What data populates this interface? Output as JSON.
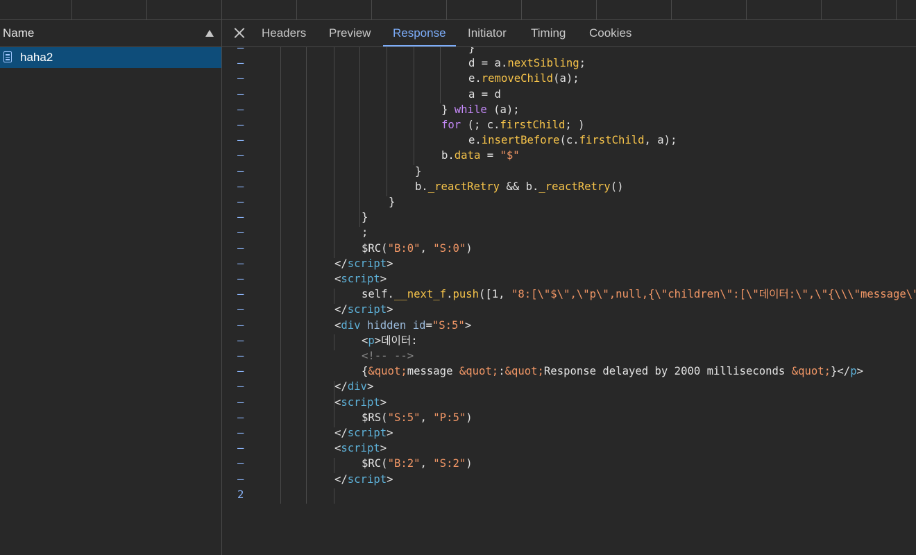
{
  "left_pane": {
    "column_header": "Name",
    "request_name": "haha2"
  },
  "tabs": [
    {
      "label": "Headers",
      "active": false
    },
    {
      "label": "Preview",
      "active": false
    },
    {
      "label": "Response",
      "active": true
    },
    {
      "label": "Initiator",
      "active": false
    },
    {
      "label": "Timing",
      "active": false
    },
    {
      "label": "Cookies",
      "active": false
    }
  ],
  "colors": {
    "accent": "#7cacf8",
    "keyword": "#c58af9",
    "property": "#f7c44a",
    "string": "#f29766",
    "tag": "#5db0d7",
    "selected_row": "#0e4d7a"
  },
  "code_lines": [
    {
      "num": "–",
      "tokens": [
        {
          "t": "}",
          "k": "c"
        }
      ]
    },
    {
      "num": "–",
      "tokens": [
        {
          "t": "d = a.",
          "k": "c"
        },
        {
          "t": "nextSibling",
          "k": "p"
        },
        {
          "t": ";",
          "k": "c"
        }
      ]
    },
    {
      "num": "–",
      "tokens": [
        {
          "t": "e.",
          "k": "c"
        },
        {
          "t": "removeChild",
          "k": "p"
        },
        {
          "t": "(a);",
          "k": "c"
        }
      ]
    },
    {
      "num": "–",
      "tokens": [
        {
          "t": "a = d",
          "k": "c"
        }
      ]
    },
    {
      "num": "–",
      "tokens": [
        {
          "t": "} ",
          "k": "c"
        },
        {
          "t": "while",
          "k": "k"
        },
        {
          "t": " (a);",
          "k": "c"
        }
      ]
    },
    {
      "num": "–",
      "tokens": [
        {
          "t": "for",
          "k": "k"
        },
        {
          "t": " (; c.",
          "k": "c"
        },
        {
          "t": "firstChild",
          "k": "p"
        },
        {
          "t": "; )",
          "k": "c"
        }
      ]
    },
    {
      "num": "–",
      "tokens": [
        {
          "t": "e.",
          "k": "c"
        },
        {
          "t": "insertBefore",
          "k": "p"
        },
        {
          "t": "(c.",
          "k": "c"
        },
        {
          "t": "firstChild",
          "k": "p"
        },
        {
          "t": ", a);",
          "k": "c"
        }
      ]
    },
    {
      "num": "–",
      "tokens": [
        {
          "t": "b.",
          "k": "c"
        },
        {
          "t": "data",
          "k": "p"
        },
        {
          "t": " = ",
          "k": "c"
        },
        {
          "t": "\"$\"",
          "k": "s"
        }
      ]
    },
    {
      "num": "–",
      "tokens": [
        {
          "t": "}",
          "k": "c"
        }
      ]
    },
    {
      "num": "–",
      "tokens": [
        {
          "t": "b.",
          "k": "c"
        },
        {
          "t": "_reactRetry",
          "k": "p"
        },
        {
          "t": " && b.",
          "k": "c"
        },
        {
          "t": "_reactRetry",
          "k": "p"
        },
        {
          "t": "()",
          "k": "c"
        }
      ]
    },
    {
      "num": "–",
      "tokens": [
        {
          "t": "}",
          "k": "c"
        }
      ]
    },
    {
      "num": "–",
      "tokens": [
        {
          "t": "}",
          "k": "c"
        }
      ]
    },
    {
      "num": "–",
      "tokens": [
        {
          "t": ";",
          "k": "c"
        }
      ]
    },
    {
      "num": "–",
      "tokens": [
        {
          "t": "$RC(",
          "k": "c"
        },
        {
          "t": "\"B:0\"",
          "k": "s"
        },
        {
          "t": ", ",
          "k": "c"
        },
        {
          "t": "\"S:0\"",
          "k": "s"
        },
        {
          "t": ")",
          "k": "c"
        }
      ]
    },
    {
      "num": "–",
      "tokens": [
        {
          "t": "</",
          "k": "c"
        },
        {
          "t": "script",
          "k": "g"
        },
        {
          "t": ">",
          "k": "c"
        }
      ]
    },
    {
      "num": "–",
      "tokens": [
        {
          "t": "<",
          "k": "c"
        },
        {
          "t": "script",
          "k": "g"
        },
        {
          "t": ">",
          "k": "c"
        }
      ]
    },
    {
      "num": "–",
      "tokens": [
        {
          "t": "self.",
          "k": "c"
        },
        {
          "t": "__next_f",
          "k": "p"
        },
        {
          "t": ".",
          "k": "c"
        },
        {
          "t": "push",
          "k": "p"
        },
        {
          "t": "([1, ",
          "k": "c"
        },
        {
          "t": "\"8:[\\\"$\\\",\\\"p\\\",null,{\\\"children\\\":[\\\"데이터:\\\",\\\"{\\\\\\\"message\\\"",
          "k": "s"
        }
      ]
    },
    {
      "num": "–",
      "tokens": [
        {
          "t": "</",
          "k": "c"
        },
        {
          "t": "script",
          "k": "g"
        },
        {
          "t": ">",
          "k": "c"
        }
      ]
    },
    {
      "num": "–",
      "tokens": [
        {
          "t": "<",
          "k": "c"
        },
        {
          "t": "div",
          "k": "g"
        },
        {
          "t": " ",
          "k": "c"
        },
        {
          "t": "hidden",
          "k": "a"
        },
        {
          "t": " ",
          "k": "c"
        },
        {
          "t": "id",
          "k": "a"
        },
        {
          "t": "=",
          "k": "c"
        },
        {
          "t": "\"S:5\"",
          "k": "s"
        },
        {
          "t": ">",
          "k": "c"
        }
      ]
    },
    {
      "num": "–",
      "tokens": [
        {
          "t": "<",
          "k": "c"
        },
        {
          "t": "p",
          "k": "g"
        },
        {
          "t": ">데이터:",
          "k": "c"
        }
      ]
    },
    {
      "num": "–",
      "tokens": [
        {
          "t": "<!-- -->",
          "k": "m"
        }
      ]
    },
    {
      "num": "–",
      "tokens": [
        {
          "t": "{",
          "k": "c"
        },
        {
          "t": "&quot;",
          "k": "s"
        },
        {
          "t": "message ",
          "k": "c"
        },
        {
          "t": "&quot;",
          "k": "s"
        },
        {
          "t": ":",
          "k": "c"
        },
        {
          "t": "&quot;",
          "k": "s"
        },
        {
          "t": "Response delayed by 2000 milliseconds ",
          "k": "c"
        },
        {
          "t": "&quot;",
          "k": "s"
        },
        {
          "t": "}</",
          "k": "c"
        },
        {
          "t": "p",
          "k": "g"
        },
        {
          "t": ">",
          "k": "c"
        }
      ]
    },
    {
      "num": "–",
      "tokens": [
        {
          "t": "</",
          "k": "c"
        },
        {
          "t": "div",
          "k": "g"
        },
        {
          "t": ">",
          "k": "c"
        }
      ]
    },
    {
      "num": "–",
      "tokens": [
        {
          "t": "<",
          "k": "c"
        },
        {
          "t": "script",
          "k": "g"
        },
        {
          "t": ">",
          "k": "c"
        }
      ]
    },
    {
      "num": "–",
      "tokens": [
        {
          "t": "$RS(",
          "k": "c"
        },
        {
          "t": "\"S:5\"",
          "k": "s"
        },
        {
          "t": ", ",
          "k": "c"
        },
        {
          "t": "\"P:5\"",
          "k": "s"
        },
        {
          "t": ")",
          "k": "c"
        }
      ]
    },
    {
      "num": "–",
      "tokens": [
        {
          "t": "</",
          "k": "c"
        },
        {
          "t": "script",
          "k": "g"
        },
        {
          "t": ">",
          "k": "c"
        }
      ]
    },
    {
      "num": "–",
      "tokens": [
        {
          "t": "<",
          "k": "c"
        },
        {
          "t": "script",
          "k": "g"
        },
        {
          "t": ">",
          "k": "c"
        }
      ]
    },
    {
      "num": "–",
      "tokens": [
        {
          "t": "$RC(",
          "k": "c"
        },
        {
          "t": "\"B:2\"",
          "k": "s"
        },
        {
          "t": ", ",
          "k": "c"
        },
        {
          "t": "\"S:2\"",
          "k": "s"
        },
        {
          "t": ")",
          "k": "c"
        }
      ]
    },
    {
      "num": "–",
      "tokens": [
        {
          "t": "</",
          "k": "c"
        },
        {
          "t": "script",
          "k": "g"
        },
        {
          "t": ">",
          "k": "c"
        }
      ]
    },
    {
      "num": "2",
      "tokens": []
    }
  ]
}
